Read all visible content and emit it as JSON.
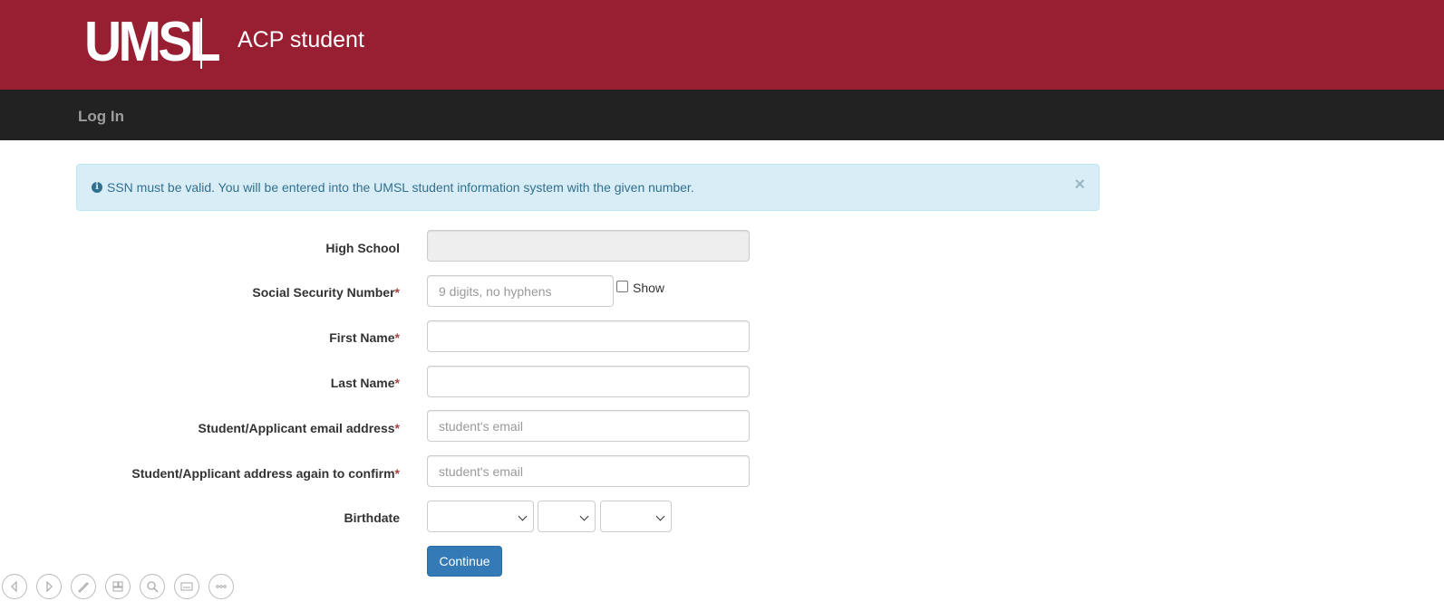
{
  "header": {
    "logo_text": "UMSL",
    "app_title": "ACP student",
    "brand_color": "#981e32"
  },
  "nav": {
    "login_label": "Log In"
  },
  "alert": {
    "icon": "info-icon",
    "message": "SSN must be valid. You will be entered into the UMSL student information system with the given number.",
    "close_label": "×"
  },
  "form": {
    "high_school": {
      "label": "High School",
      "value": ""
    },
    "ssn": {
      "label": "Social Security Number",
      "required": "*",
      "placeholder": "9 digits, no hyphens",
      "show_label": "Show"
    },
    "first_name": {
      "label": "First Name",
      "required": "*",
      "value": ""
    },
    "last_name": {
      "label": "Last Name",
      "required": "*",
      "value": ""
    },
    "email": {
      "label": "Student/Applicant email address",
      "required": "*",
      "placeholder": "student's email"
    },
    "email_confirm": {
      "label": "Student/Applicant address again to confirm",
      "required": "*",
      "placeholder": "student's email"
    },
    "birthdate": {
      "label": "Birthdate",
      "month": "",
      "day": "",
      "year": ""
    },
    "continue_label": "Continue",
    "button_color": "#337ab7"
  },
  "toolbar": {
    "icons": [
      "previous-icon",
      "next-icon",
      "pen-icon",
      "slides-icon",
      "zoom-icon",
      "subtitles-icon",
      "more-icon"
    ]
  }
}
